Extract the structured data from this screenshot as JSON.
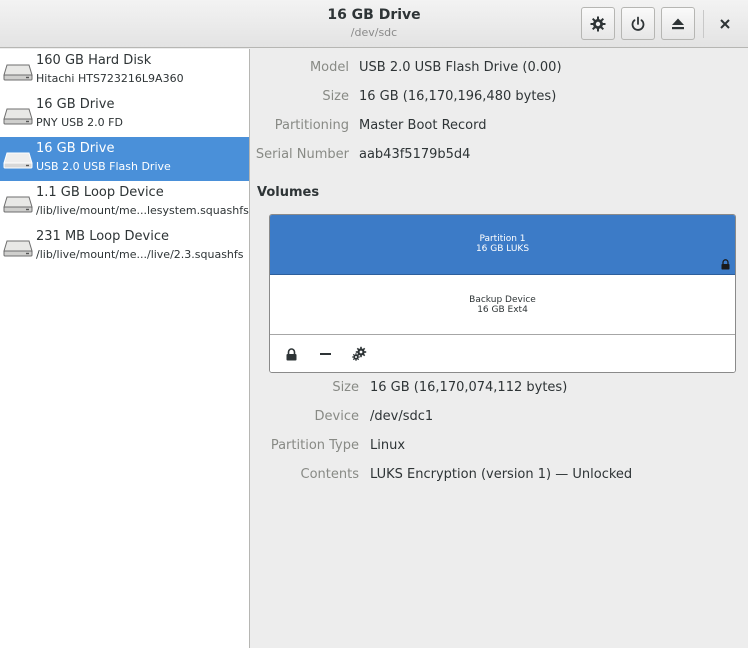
{
  "window": {
    "title": "16 GB Drive",
    "subtitle": "/dev/sdc",
    "buttons": [
      {
        "name": "drive-settings",
        "icon": "gear-icon"
      },
      {
        "name": "power-off",
        "icon": "power-icon"
      },
      {
        "name": "eject",
        "icon": "eject-icon"
      }
    ],
    "close_icon": "close-icon"
  },
  "sidebar": {
    "devices": [
      {
        "name": "160 GB Hard Disk",
        "description": "Hitachi HTS723216L9A360",
        "selected": false,
        "icon": "drive-icon"
      },
      {
        "name": "16 GB Drive",
        "description": "PNY USB 2.0 FD",
        "selected": false,
        "icon": "drive-icon"
      },
      {
        "name": "16 GB Drive",
        "description": "USB 2.0 USB Flash Drive",
        "selected": true,
        "icon": "drive-icon"
      },
      {
        "name": "1.1 GB Loop Device",
        "description": "/lib/live/mount/me...lesystem.squashfs",
        "selected": false,
        "icon": "drive-icon"
      },
      {
        "name": "231 MB Loop Device",
        "description": "/lib/live/mount/me.../live/2.3.squashfs",
        "selected": false,
        "icon": "drive-icon"
      }
    ]
  },
  "drive": {
    "model_label": "Model",
    "model": "USB 2.0 USB Flash Drive (0.00)",
    "size_label": "Size",
    "size": "16 GB (16,170,196,480 bytes)",
    "partitioning_label": "Partitioning",
    "partitioning": "Master Boot Record",
    "serial_label": "Serial Number",
    "serial": "aab43f5179b5d4"
  },
  "volumes": {
    "heading": "Volumes",
    "partition": {
      "title": "Partition 1",
      "subtitle": "16 GB LUKS",
      "icon": "lock-icon"
    },
    "inner": {
      "title": "Backup Device",
      "subtitle": "16 GB Ext4"
    },
    "toolbar": [
      {
        "name": "lock",
        "icon": "lock-icon"
      },
      {
        "name": "remove",
        "icon": "minus-icon"
      },
      {
        "name": "options",
        "icon": "gears-icon"
      }
    ]
  },
  "partition_details": {
    "size_label": "Size",
    "size": "16 GB (16,170,074,112 bytes)",
    "device_label": "Device",
    "device": "/dev/sdc1",
    "type_label": "Partition Type",
    "type": "Linux",
    "contents_label": "Contents",
    "contents": "LUKS Encryption (version 1) — Unlocked"
  },
  "colors": {
    "selection": "#4a90d9",
    "partition_bar": "#3c7bc7"
  }
}
